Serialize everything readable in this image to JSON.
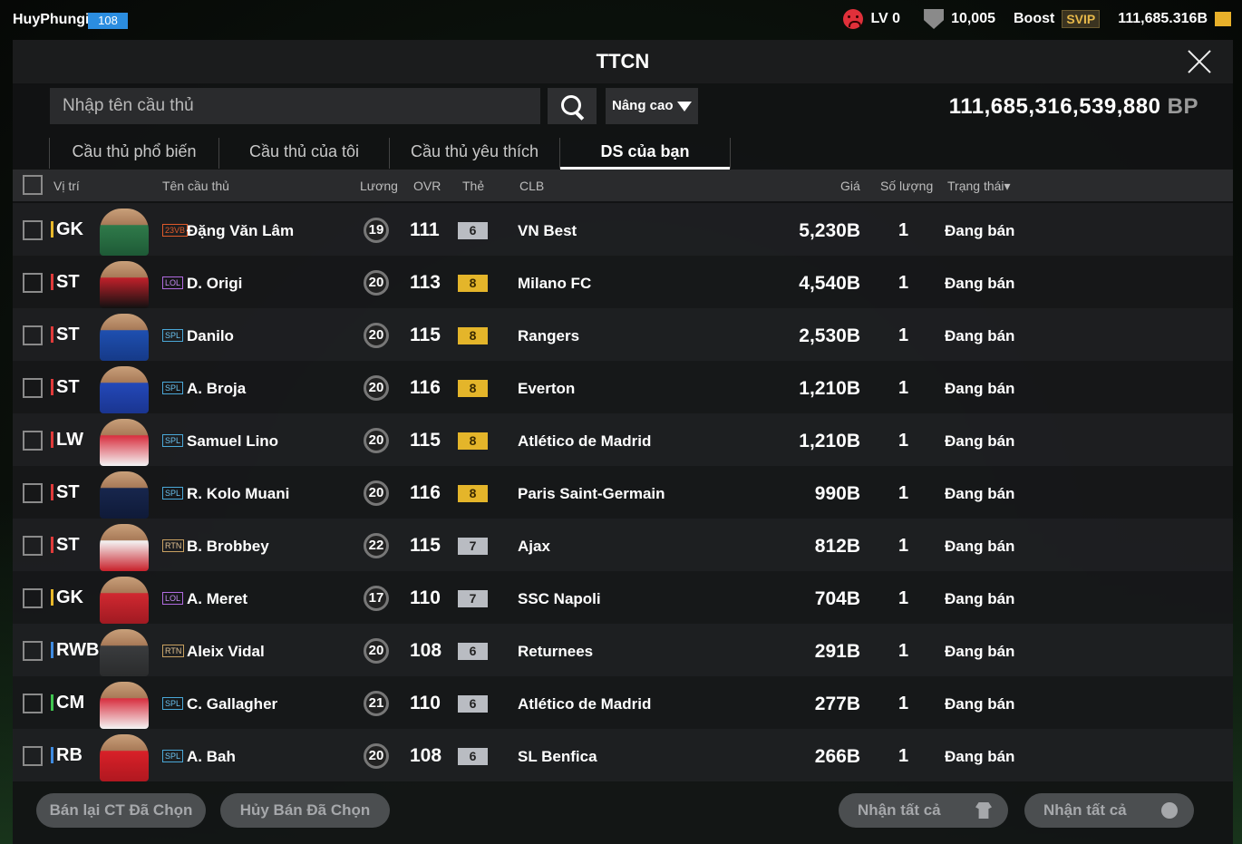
{
  "topbar": {
    "username": "HuyPhungi",
    "user_level": "108",
    "lv": "LV 0",
    "points": "10,005",
    "boost": "Boost",
    "svip": "SVIP",
    "coins": "111,685.316B"
  },
  "panel": {
    "title": "TTCN",
    "search_placeholder": "Nhập tên cầu thủ",
    "advanced": "Nâng cao",
    "bp_amount": "111,685,316,539,880",
    "bp_unit": "BP"
  },
  "tabs": [
    "Cầu thủ phổ biến",
    "Cầu thủ của tôi",
    "Cầu thủ yêu thích",
    "DS của bạn"
  ],
  "active_tab": 3,
  "columns": {
    "position": "Vị trí",
    "name": "Tên cầu thủ",
    "wage": "Lương",
    "ovr": "OVR",
    "card": "Thẻ",
    "club": "CLB",
    "price": "Giá",
    "qty": "Số lượng",
    "status": "Trạng thái▾"
  },
  "position_colors": {
    "GK": "#e8b82a",
    "ST": "#e03a3a",
    "LW": "#e03a3a",
    "RWB": "#3f8be0",
    "CM": "#3fc44f",
    "RB": "#3f8be0"
  },
  "season_styles": {
    "23VB": {
      "border": "#e05a2a",
      "color": "#e05a2a"
    },
    "LOL": {
      "border": "#b06ae0",
      "color": "#c48af0"
    },
    "SPL": {
      "border": "#4aa8d8",
      "color": "#6ac0ee"
    },
    "RTN": {
      "border": "#c8a060",
      "color": "#e0c090"
    }
  },
  "players": [
    {
      "pos": "GK",
      "season": "23VB",
      "name": "Đặng Văn Lâm",
      "wage": "19",
      "ovr": "111",
      "grade": "6",
      "club": "VN Best",
      "price": "5,230B",
      "qty": "1",
      "status": "Đang bán",
      "kit": [
        "#2f7a4a",
        "#1e5a36"
      ]
    },
    {
      "pos": "ST",
      "season": "LOL",
      "name": "D. Origi",
      "wage": "20",
      "ovr": "113",
      "grade": "8",
      "club": "Milano FC",
      "price": "4,540B",
      "qty": "1",
      "status": "Đang bán",
      "kit": [
        "#c0202a",
        "#111"
      ]
    },
    {
      "pos": "ST",
      "season": "SPL",
      "name": "Danilo",
      "wage": "20",
      "ovr": "115",
      "grade": "8",
      "club": "Rangers",
      "price": "2,530B",
      "qty": "1",
      "status": "Đang bán",
      "kit": [
        "#1e4fb0",
        "#163a88"
      ]
    },
    {
      "pos": "ST",
      "season": "SPL",
      "name": "A. Broja",
      "wage": "20",
      "ovr": "116",
      "grade": "8",
      "club": "Everton",
      "price": "1,210B",
      "qty": "1",
      "status": "Đang bán",
      "kit": [
        "#2348b8",
        "#1a3590"
      ]
    },
    {
      "pos": "LW",
      "season": "SPL",
      "name": "Samuel Lino",
      "wage": "20",
      "ovr": "115",
      "grade": "8",
      "club": "Atlético de Madrid",
      "price": "1,210B",
      "qty": "1",
      "status": "Đang bán",
      "kit": [
        "#d83040",
        "#f4f4f4"
      ]
    },
    {
      "pos": "ST",
      "season": "SPL",
      "name": "R. Kolo Muani",
      "wage": "20",
      "ovr": "116",
      "grade": "8",
      "club": "Paris Saint-Germain",
      "price": "990B",
      "qty": "1",
      "status": "Đang bán",
      "kit": [
        "#17264d",
        "#0f1a38"
      ]
    },
    {
      "pos": "ST",
      "season": "RTN",
      "name": "B. Brobbey",
      "wage": "22",
      "ovr": "115",
      "grade": "7",
      "club": "Ajax",
      "price": "812B",
      "qty": "1",
      "status": "Đang bán",
      "kit": [
        "#f4f4f4",
        "#c8202a"
      ]
    },
    {
      "pos": "GK",
      "season": "LOL",
      "name": "A. Meret",
      "wage": "17",
      "ovr": "110",
      "grade": "7",
      "club": "SSC Napoli",
      "price": "704B",
      "qty": "1",
      "status": "Đang bán",
      "kit": [
        "#d02830",
        "#a01a22"
      ]
    },
    {
      "pos": "RWB",
      "season": "RTN",
      "name": "Aleix Vidal",
      "wage": "20",
      "ovr": "108",
      "grade": "6",
      "club": "Returnees",
      "price": "291B",
      "qty": "1",
      "status": "Đang bán",
      "kit": [
        "#3a3c3e",
        "#2a2b2c"
      ]
    },
    {
      "pos": "CM",
      "season": "SPL",
      "name": "C. Gallagher",
      "wage": "21",
      "ovr": "110",
      "grade": "6",
      "club": "Atlético de Madrid",
      "price": "277B",
      "qty": "1",
      "status": "Đang bán",
      "kit": [
        "#d83040",
        "#f4f4f4"
      ]
    },
    {
      "pos": "RB",
      "season": "SPL",
      "name": "A. Bah",
      "wage": "20",
      "ovr": "108",
      "grade": "6",
      "club": "SL Benfica",
      "price": "266B",
      "qty": "1",
      "status": "Đang bán",
      "kit": [
        "#d82028",
        "#b01820"
      ]
    }
  ],
  "bottom": {
    "resell": "Bán lại CT Đã Chọn",
    "cancel": "Hủy Bán Đã Chọn",
    "claim_players": "Nhận tất cả",
    "claim_bp": "Nhận tất cả"
  }
}
